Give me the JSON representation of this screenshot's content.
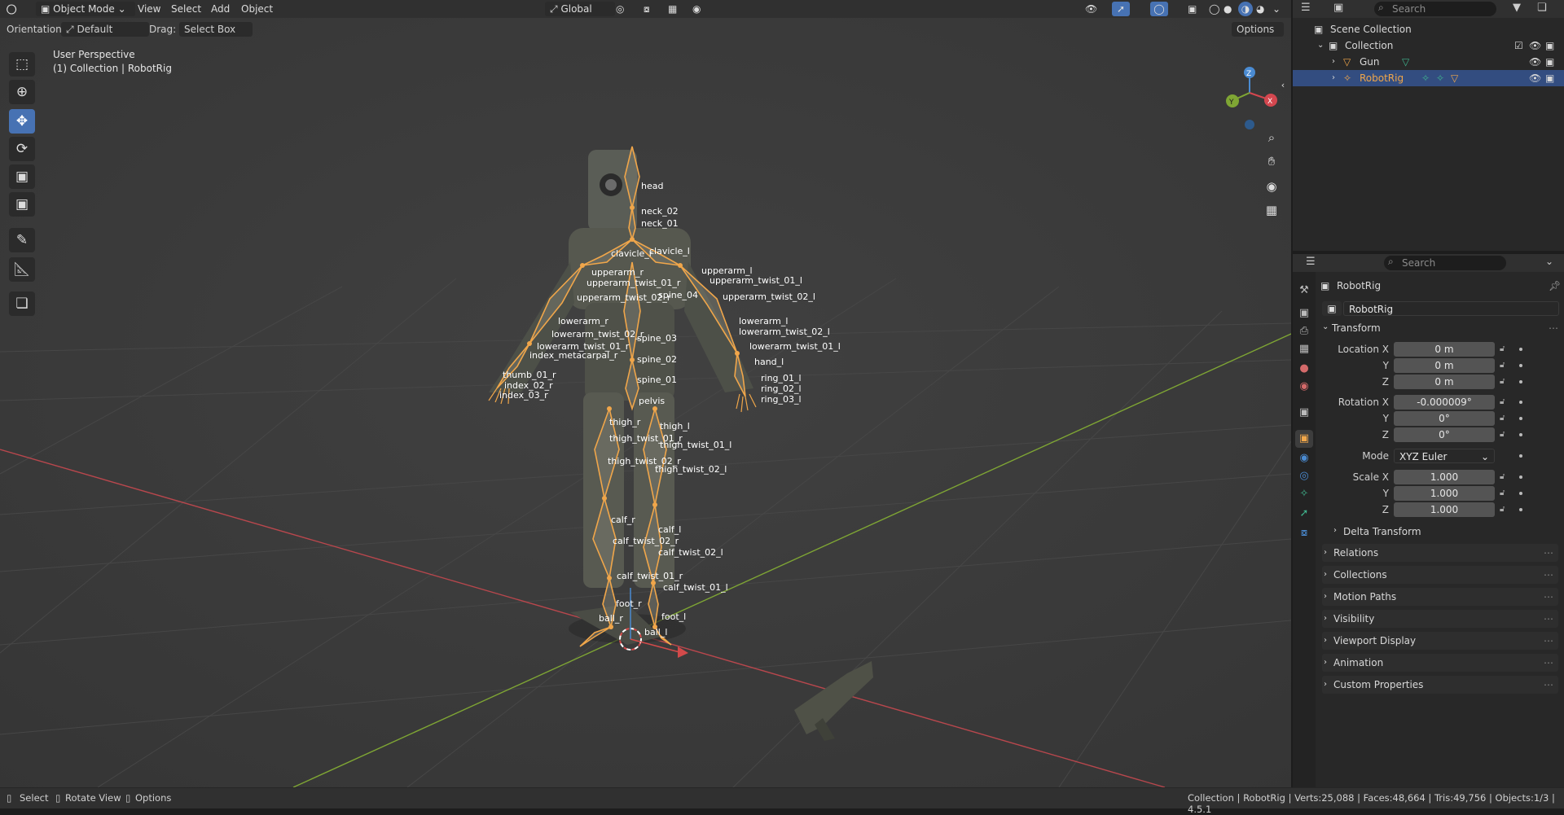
{
  "header": {
    "mode": "Object Mode",
    "menus": [
      "View",
      "Select",
      "Add",
      "Object"
    ],
    "transform_orientation": "Global",
    "options_label": "Options"
  },
  "subheader": {
    "orientation_label": "Orientation:",
    "orientation_value": "Default",
    "drag_label": "Drag:",
    "drag_value": "Select Box"
  },
  "viewport": {
    "perspective": "User Perspective",
    "context": "(1) Collection | RobotRig",
    "gizmo_axes": [
      "Z",
      "X",
      "Y"
    ],
    "bone_labels": [
      "head",
      "neck_02",
      "neck_01",
      "clavicle_r",
      "clavicle_l",
      "upperarm_r",
      "upperarm_l",
      "upperarm_twist_01_r",
      "upperarm_twist_01_l",
      "upperarm_twist_02_r",
      "upperarm_twist_02_l",
      "spine_04",
      "lowerarm_r",
      "lowerarm_l",
      "lowerarm_twist_02_r",
      "lowerarm_twist_02_l",
      "lowerarm_twist_01_r",
      "lowerarm_twist_01_l",
      "spine_03",
      "spine_02",
      "spine_01",
      "pelvis",
      "hand_l",
      "thumb_01_r",
      "index_metacarpal_r",
      "index_02_r",
      "index_03_r",
      "ring_01_l",
      "ring_02_l",
      "ring_03_l",
      "thigh_r",
      "thigh_l",
      "thigh_twist_01_r",
      "thigh_twist_01_l",
      "thigh_twist_02_r",
      "thigh_twist_02_l",
      "calf_r",
      "calf_l",
      "calf_twist_02_r",
      "calf_twist_02_l",
      "calf_twist_01_r",
      "calf_twist_01_l",
      "foot_r",
      "foot_l",
      "ball_r",
      "ball_l"
    ]
  },
  "outliner": {
    "search_placeholder": "Search",
    "scene_collection": "Scene Collection",
    "collection": "Collection",
    "items": [
      {
        "name": "Gun",
        "selected": false
      },
      {
        "name": "RobotRig",
        "selected": true
      }
    ]
  },
  "properties": {
    "search_placeholder": "Search",
    "object_name": "RobotRig",
    "datablock_name": "RobotRig",
    "transform_title": "Transform",
    "location_label": "Location X",
    "location": {
      "x": "0 m",
      "y": "0 m",
      "z": "0 m"
    },
    "rotation_label": "Rotation X",
    "rotation": {
      "x": "-0.000009°",
      "y": "0°",
      "z": "0°"
    },
    "mode_label": "Mode",
    "mode_value": "XYZ Euler",
    "scale_label": "Scale X",
    "scale": {
      "x": "1.000",
      "y": "1.000",
      "z": "1.000"
    },
    "axis_y": "Y",
    "axis_z": "Z",
    "delta_transform": "Delta Transform",
    "sections": [
      "Relations",
      "Collections",
      "Motion Paths",
      "Visibility",
      "Viewport Display",
      "Animation",
      "Custom Properties"
    ]
  },
  "statusbar": {
    "select": "Select",
    "rotate_view": "Rotate View",
    "options": "Options",
    "stats": "Collection | RobotRig | Verts:25,088 | Faces:48,664 | Tris:49,756 | Objects:1/3 | 4.5.1"
  },
  "colors": {
    "selection_orange": "#f0a64a",
    "active_blue": "#4772b3",
    "x_axis": "#d4474f",
    "y_axis": "#7fa634"
  }
}
